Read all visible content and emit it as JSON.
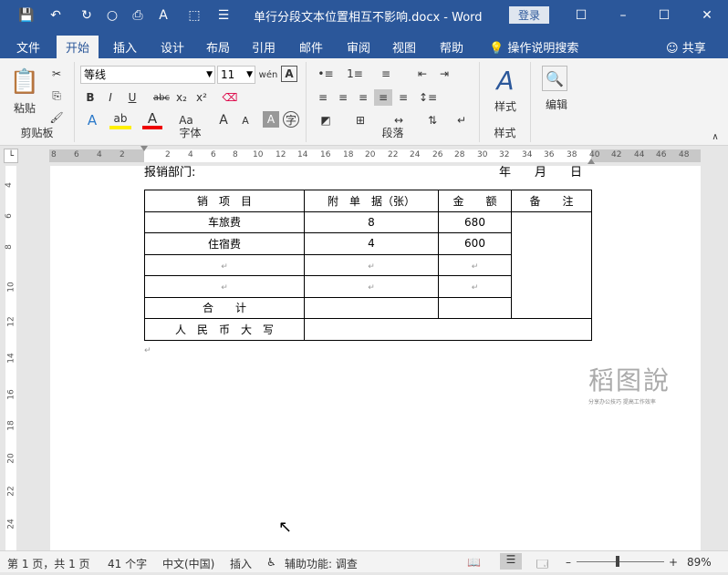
{
  "window": {
    "title": "单行分段文本位置相互不影响.docx  -  Word",
    "login_label": "登录"
  },
  "tabs": [
    "文件",
    "开始",
    "插入",
    "设计",
    "布局",
    "引用",
    "邮件",
    "审阅",
    "视图",
    "帮助"
  ],
  "active_tab": "开始",
  "tell_me": "操作说明搜索",
  "share": "共享",
  "ribbon": {
    "clipboard": {
      "paste_label": "粘贴",
      "group_label": "剪贴板"
    },
    "font": {
      "font_name": "等线",
      "font_size": "11",
      "group_label": "字体"
    },
    "paragraph": {
      "group_label": "段落"
    },
    "styles": {
      "label": "样式",
      "group_label": "样式"
    },
    "editing": {
      "label": "编辑"
    }
  },
  "ruler": {
    "left_numbers": [
      "8",
      "6",
      "4",
      "2"
    ],
    "right_numbers": [
      "2",
      "4",
      "6",
      "8",
      "10",
      "12",
      "14",
      "16",
      "18",
      "20",
      "22",
      "24",
      "26",
      "28",
      "30",
      "32",
      "34",
      "36",
      "38"
    ],
    "margin_numbers": [
      "40",
      "42",
      "44",
      "46",
      "48"
    ],
    "vertical_numbers": [
      "4",
      "6",
      "8",
      "10",
      "12",
      "14",
      "16",
      "18",
      "20",
      "22",
      "24"
    ]
  },
  "document": {
    "header_left": "报销部门:",
    "header_right": "年　　月　　日",
    "table": {
      "headers": [
        "销　项　目",
        "附　单　据（张）",
        "金　　额",
        "备　　注"
      ],
      "rows": [
        [
          "车旅费",
          "8",
          "680",
          ""
        ],
        [
          "住宿费",
          "4",
          "600",
          ""
        ],
        [
          "",
          "",
          "",
          ""
        ],
        [
          "",
          "",
          "",
          ""
        ],
        [
          "合　　计",
          "",
          "",
          ""
        ]
      ],
      "total_row_label": "人　民　币　大　写"
    },
    "watermark": {
      "big": "稻图說",
      "small": "分享办公技巧  提高工作效率"
    }
  },
  "statusbar": {
    "page": "第 1 页，共 1 页",
    "words": "41 个字",
    "language": "中文(中国)",
    "mode": "插入",
    "accessibility": "辅助功能: 调查",
    "zoom": "89%"
  }
}
